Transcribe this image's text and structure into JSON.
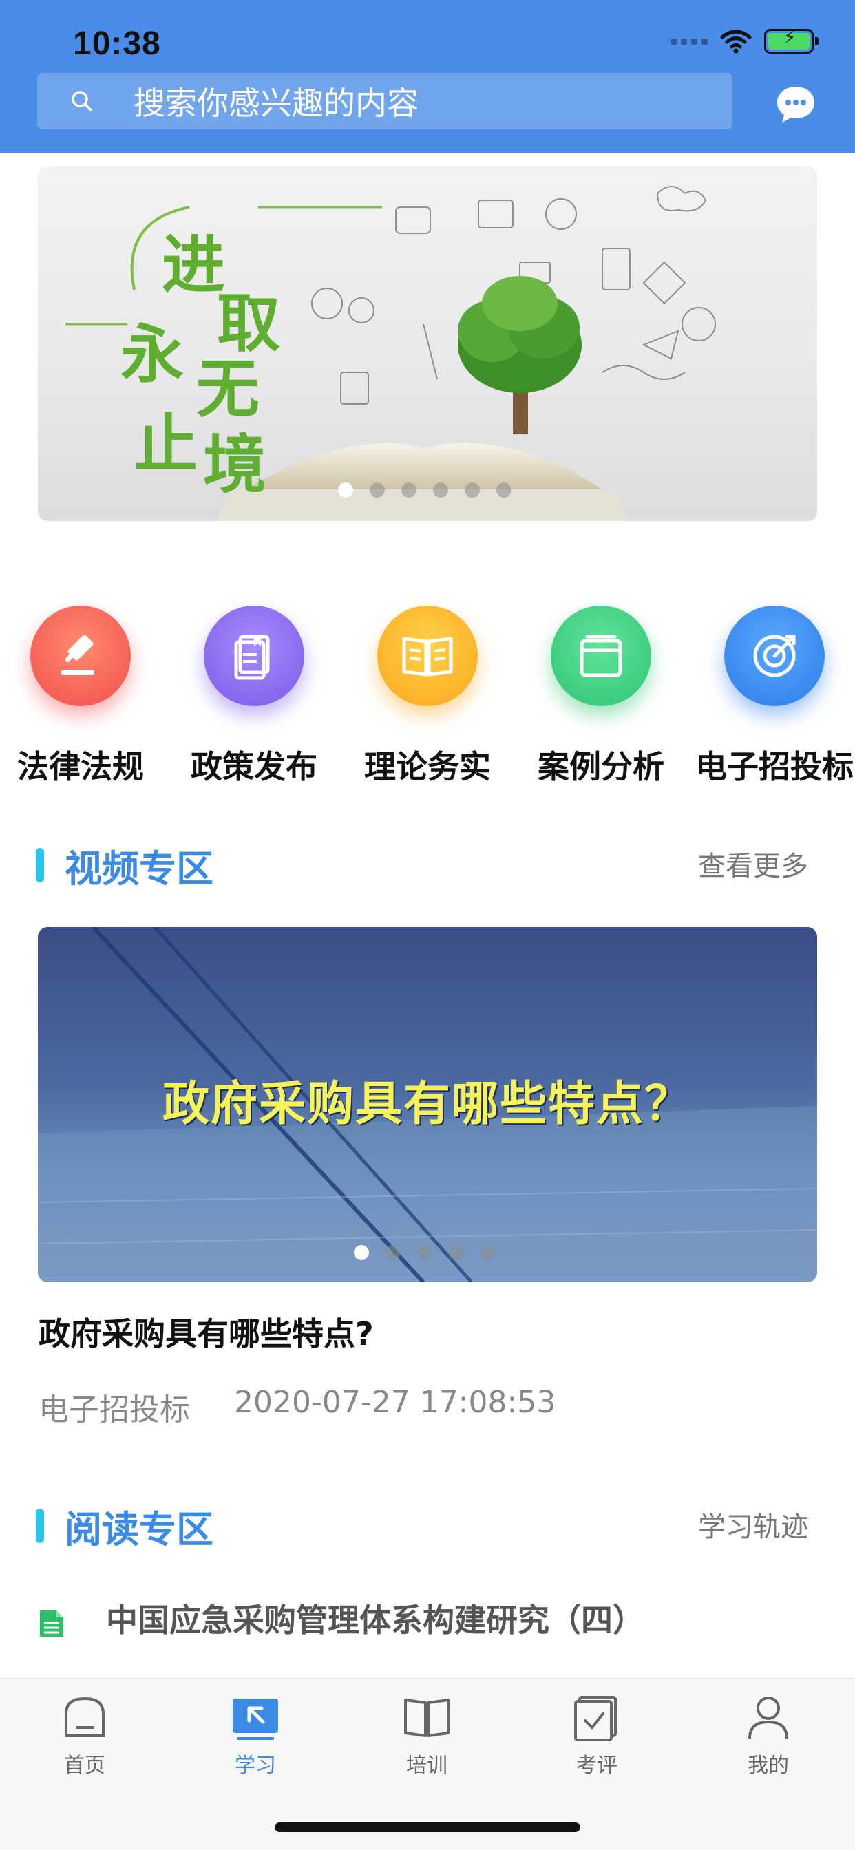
{
  "status_bar": {
    "time": "10:38"
  },
  "search": {
    "placeholder": "搜索你感兴趣的内容"
  },
  "banner": {
    "caption_chars": [
      "进",
      "取",
      "永",
      "无",
      "止",
      "境"
    ],
    "slide_count": 6,
    "active_index": 0
  },
  "categories": [
    {
      "label": "法律法规",
      "icon": "gavel-icon",
      "color": "#f5605a"
    },
    {
      "label": "政策发布",
      "icon": "document-icon",
      "color": "#8c6df0"
    },
    {
      "label": "理论务实",
      "icon": "open-book-icon",
      "color": "#fdb32b"
    },
    {
      "label": "案例分析",
      "icon": "folder-icon",
      "color": "#3ed07f"
    },
    {
      "label": "电子招投标",
      "icon": "target-icon",
      "color": "#3a8df0"
    }
  ],
  "video_section": {
    "title": "视频专区",
    "more": "查看更多",
    "video_overlay_title": "政府采购具有哪些特点？",
    "slide_count": 5,
    "active_index": 0,
    "item": {
      "title": "政府采购具有哪些特点?",
      "category": "电子招投标",
      "datetime": "2020-07-27 17:08:53"
    }
  },
  "reading_section": {
    "title": "阅读专区",
    "more": "学习轨迹",
    "items": [
      {
        "title": "中国应急采购管理体系构建研究（四）",
        "icon": "document-icon"
      }
    ]
  },
  "tabbar": {
    "items": [
      {
        "label": "首页",
        "icon": "home-icon",
        "active": false
      },
      {
        "label": "学习",
        "icon": "learn-icon",
        "active": true
      },
      {
        "label": "培训",
        "icon": "book-icon",
        "active": false
      },
      {
        "label": "考评",
        "icon": "checklist-icon",
        "active": false
      },
      {
        "label": "我的",
        "icon": "user-icon",
        "active": false
      }
    ]
  },
  "colors": {
    "header": "#4a8de8",
    "accent": "#3b8ae6",
    "section_bar": "#27c5f0"
  }
}
